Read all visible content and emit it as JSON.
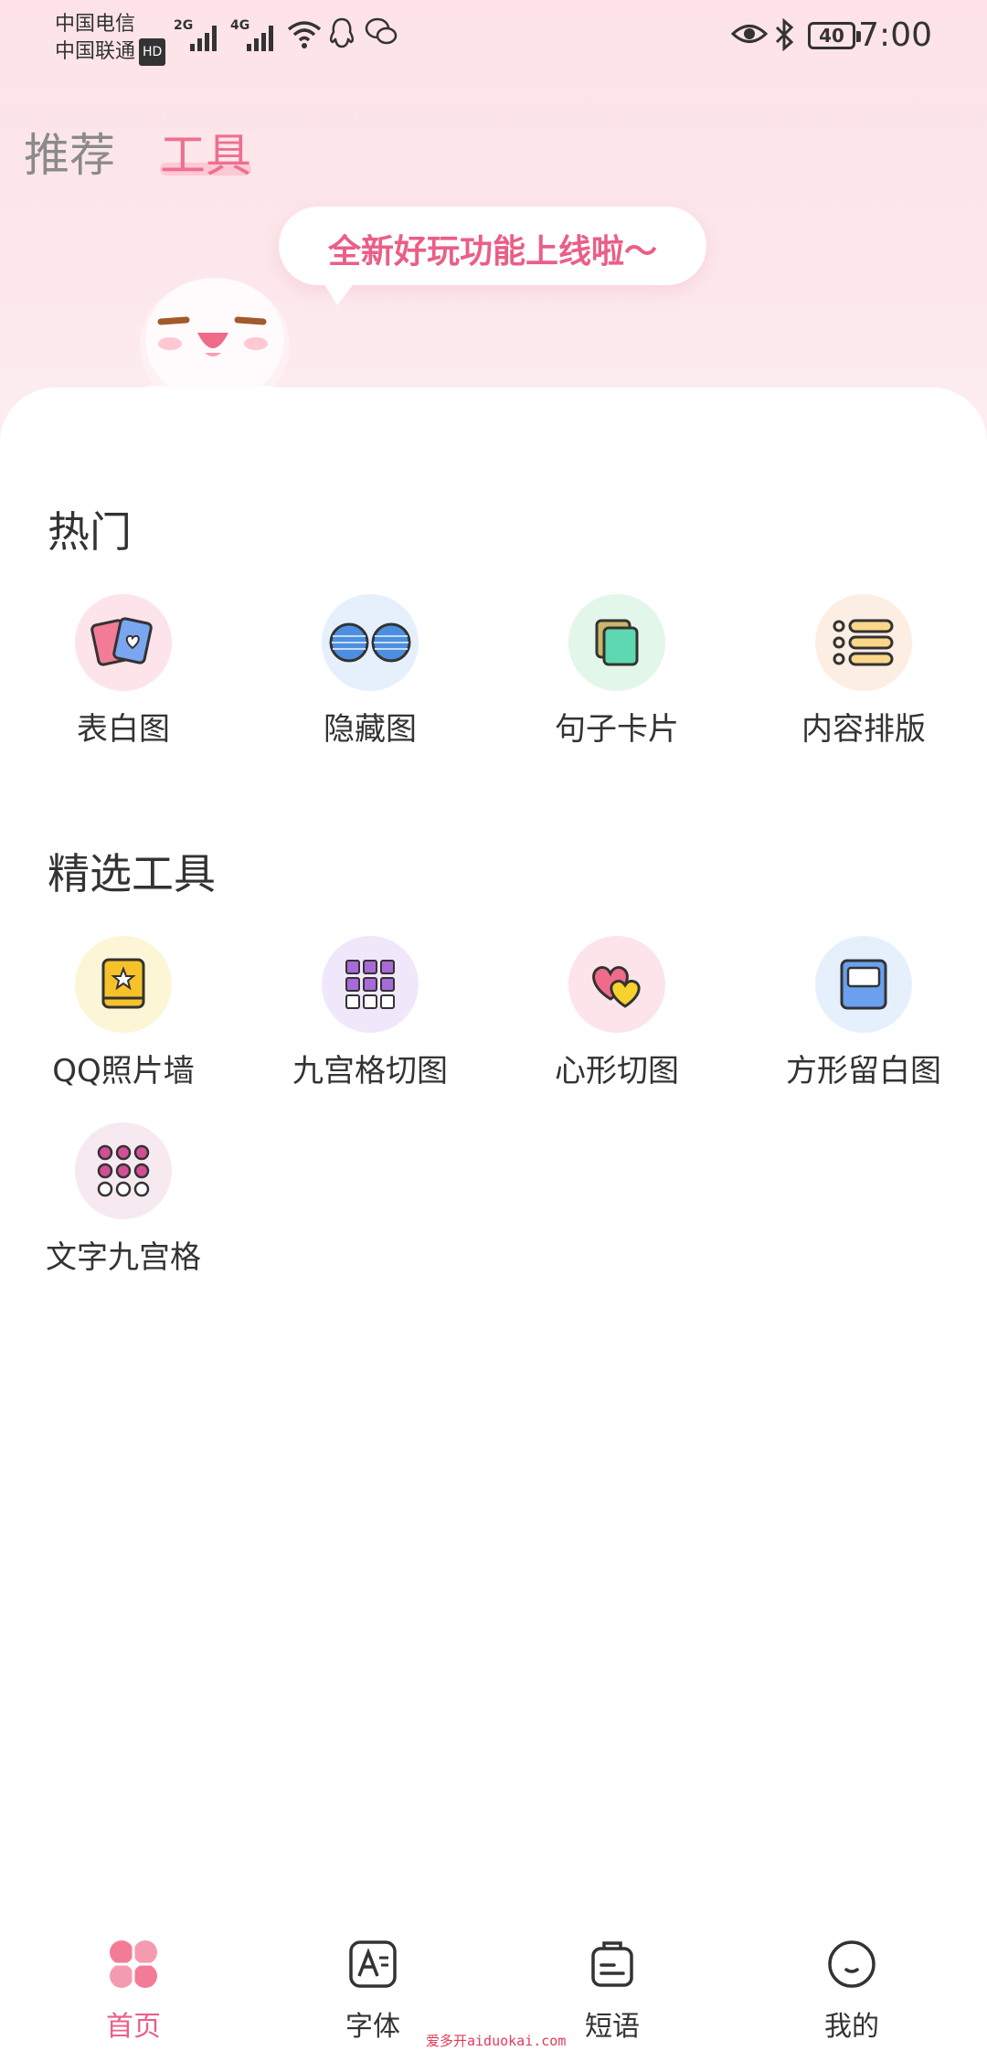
{
  "status_bar": {
    "carrier1": "中国电信",
    "carrier2": "中国联通",
    "hd": "HD",
    "net1": "2G",
    "net2": "4G",
    "battery": "40",
    "time": "7:00"
  },
  "header": {
    "tabs": [
      {
        "label": "推荐",
        "active": false
      },
      {
        "label": "工具",
        "active": true
      }
    ],
    "banner": "全新好玩功能上线啦～"
  },
  "sections": [
    {
      "title": "热门",
      "items": [
        {
          "label": "表白图",
          "icon": "photo-cards-heart-icon",
          "bg": "#fde3ea"
        },
        {
          "label": "隐藏图",
          "icon": "striped-circles-icon",
          "bg": "#e6f0fd"
        },
        {
          "label": "句子卡片",
          "icon": "stacked-cards-icon",
          "bg": "#e3f6ea"
        },
        {
          "label": "内容排版",
          "icon": "list-layout-icon",
          "bg": "#fdeee4"
        }
      ]
    },
    {
      "title": "精选工具",
      "items": [
        {
          "label": "QQ照片墙",
          "icon": "star-book-icon",
          "bg": "#fdf6d6"
        },
        {
          "label": "九宫格切图",
          "icon": "grid-nine-icon",
          "bg": "#f1e7fb"
        },
        {
          "label": "心形切图",
          "icon": "double-heart-icon",
          "bg": "#fde3ea"
        },
        {
          "label": "方形留白图",
          "icon": "square-frame-icon",
          "bg": "#e6f0fd"
        },
        {
          "label": "文字九宫格",
          "icon": "dots-grid-icon",
          "bg": "#f7e9f0"
        }
      ]
    }
  ],
  "bottom_nav": [
    {
      "label": "首页",
      "icon": "home-clover-icon",
      "active": true
    },
    {
      "label": "字体",
      "icon": "font-icon",
      "active": false
    },
    {
      "label": "短语",
      "icon": "phrase-bag-icon",
      "active": false
    },
    {
      "label": "我的",
      "icon": "profile-face-icon",
      "active": false
    }
  ],
  "watermark": "爱多开aiduokai.com",
  "colors": {
    "accent": "#ea5f86",
    "header_bg": "#fde3e8"
  }
}
